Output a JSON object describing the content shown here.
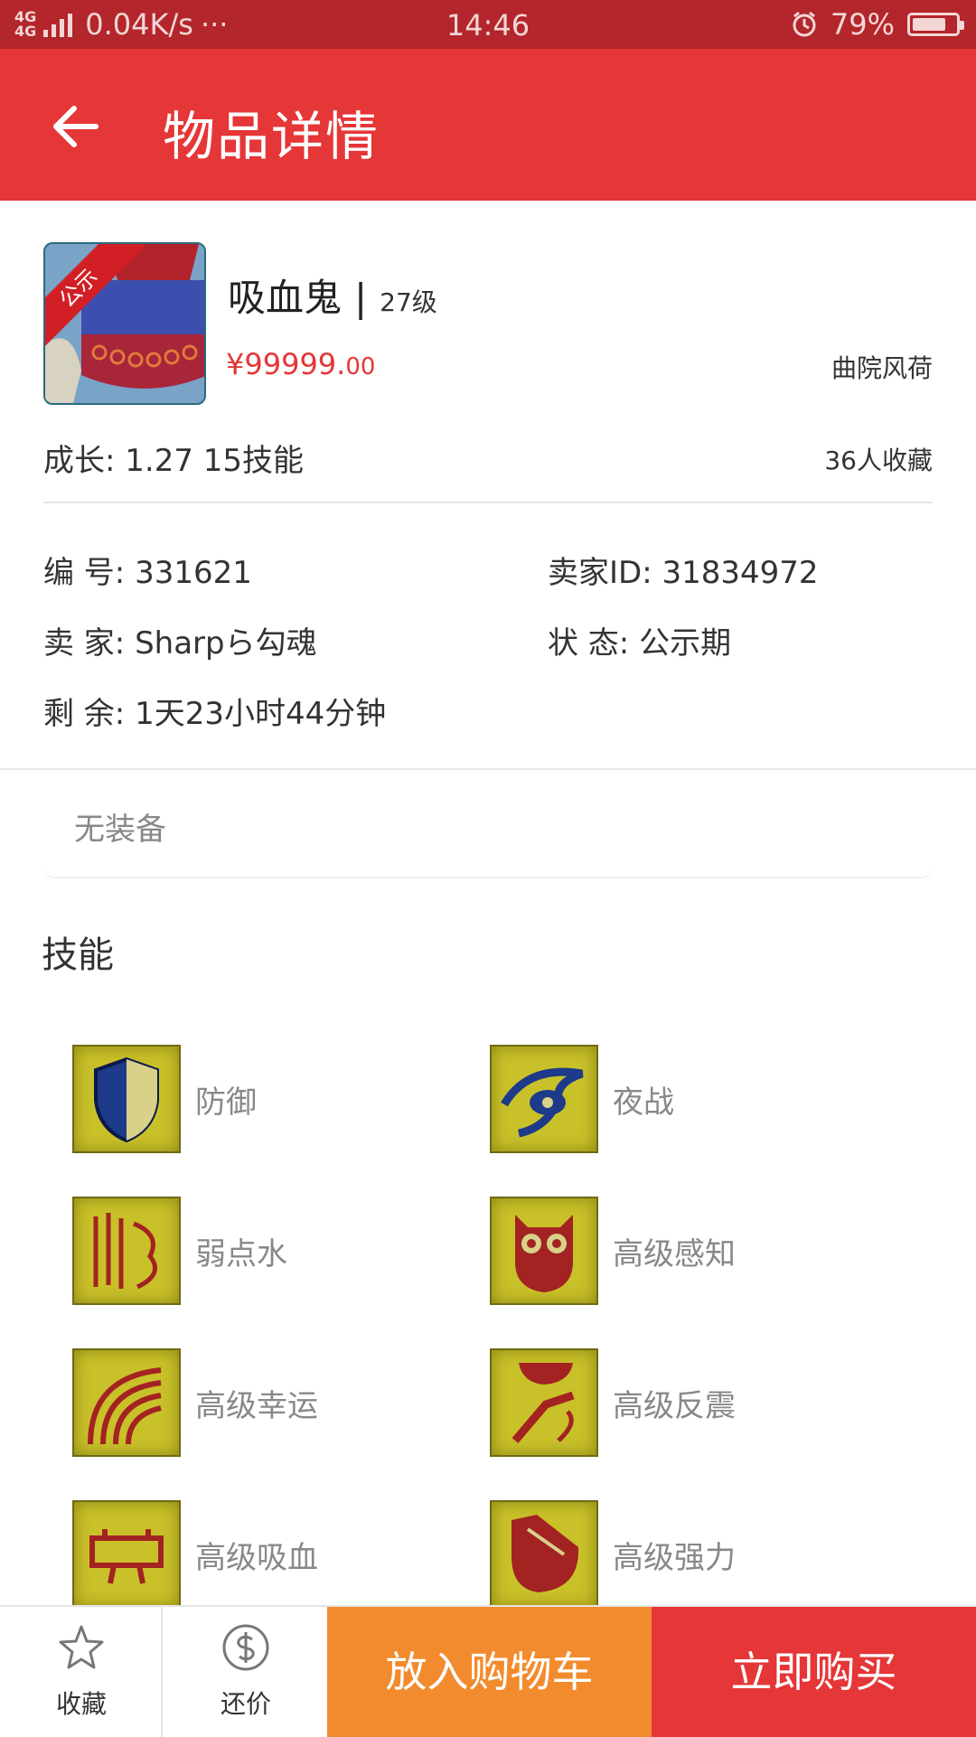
{
  "status_bar": {
    "network": "4G",
    "speed": "0.04K/s",
    "dots": "···",
    "time": "14:46",
    "battery": "79%",
    "battery_level": 0.79
  },
  "header": {
    "title": "物品详情"
  },
  "item": {
    "badge": "公示",
    "name": "吸血鬼",
    "separator": "|",
    "level": "27级",
    "price_main": "¥99999.",
    "price_decimals": "00",
    "server": "曲院风荷",
    "growth": "成长: 1.27  15技能",
    "favorites": "36人收藏"
  },
  "info": {
    "id_label": "编  号:",
    "id_value": "331621",
    "seller_id_label": "卖家ID:",
    "seller_id_value": "31834972",
    "seller_label": "卖  家:",
    "seller_value": "Sharpら勾魂",
    "status_label": "状  态:",
    "status_value": "公示期",
    "remaining_label": "剩  余:",
    "remaining_value": "1天23小时44分钟"
  },
  "equipment": {
    "empty_text": "无装备"
  },
  "skills": {
    "title": "技能",
    "items": [
      {
        "label": "防御",
        "icon": "shield-skill-icon"
      },
      {
        "label": "夜战",
        "icon": "eye-skill-icon"
      },
      {
        "label": "弱点水",
        "icon": "water-weakness-skill-icon"
      },
      {
        "label": "高级感知",
        "icon": "owl-skill-icon"
      },
      {
        "label": "高级幸运",
        "icon": "luck-skill-icon"
      },
      {
        "label": "高级反震",
        "icon": "counter-shock-skill-icon"
      },
      {
        "label": "高级吸血",
        "icon": "vampire-skill-icon"
      },
      {
        "label": "高级强力",
        "icon": "strength-skill-icon"
      }
    ]
  },
  "bottom_bar": {
    "favorite": "收藏",
    "bargain": "还价",
    "add_to_cart": "放入购物车",
    "buy_now": "立即购买"
  },
  "colors": {
    "primary": "#e53638",
    "status_bar": "#b3262b",
    "cart": "#f28b2d"
  }
}
